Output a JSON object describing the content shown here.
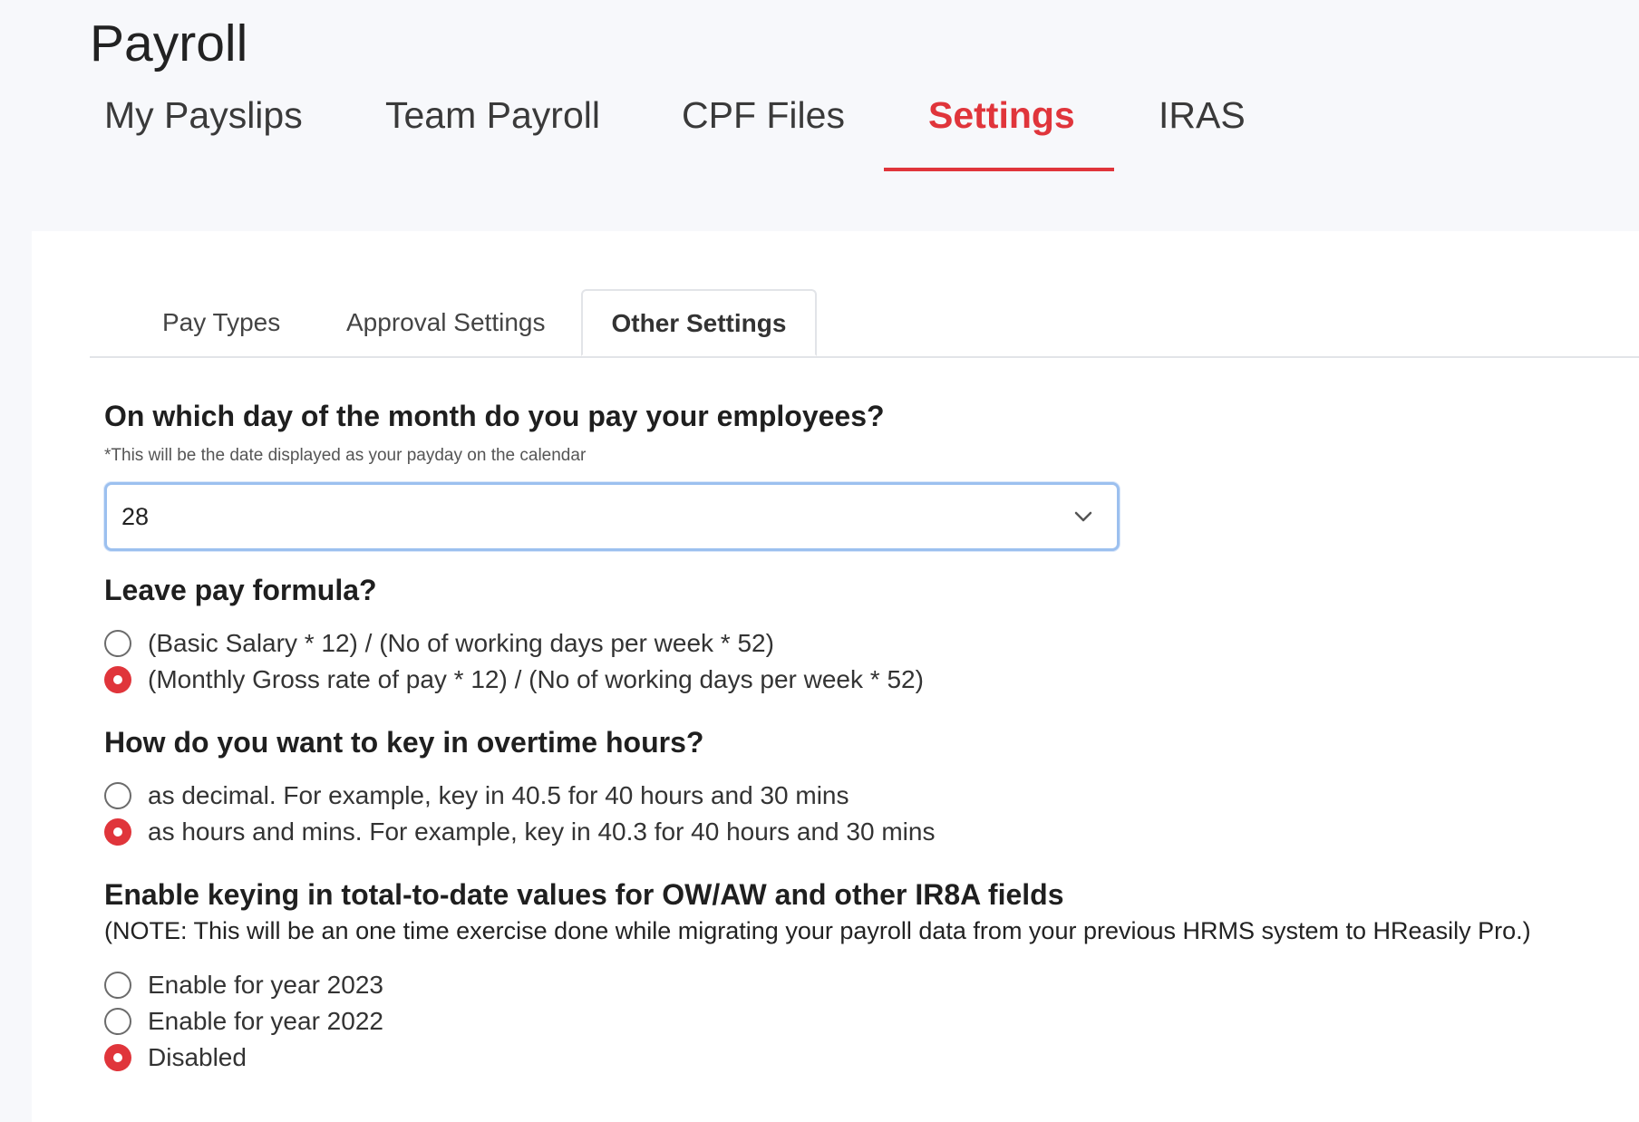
{
  "page": {
    "title": "Payroll"
  },
  "main_tabs": [
    {
      "label": "My Payslips",
      "active": false
    },
    {
      "label": "Team Payroll",
      "active": false
    },
    {
      "label": "CPF Files",
      "active": false
    },
    {
      "label": "Settings",
      "active": true
    },
    {
      "label": "IRAS",
      "active": false
    }
  ],
  "sub_tabs": [
    {
      "label": "Pay Types",
      "active": false
    },
    {
      "label": "Approval Settings",
      "active": false
    },
    {
      "label": "Other Settings",
      "active": true
    }
  ],
  "payday": {
    "question": "On which day of the month do you pay your employees?",
    "hint": "*This will be the date displayed as your payday on the calendar",
    "selected": "28",
    "icon": "chevron-down-icon"
  },
  "leave_formula": {
    "question": "Leave pay formula?",
    "options": [
      {
        "label": "(Basic Salary * 12) / (No of working days per week * 52)",
        "checked": false
      },
      {
        "label": "(Monthly Gross rate of pay * 12) / (No of working days per week * 52)",
        "checked": true
      }
    ]
  },
  "overtime": {
    "question": "How do you want to key in overtime hours?",
    "options": [
      {
        "label": "as decimal. For example, key in 40.5 for 40 hours and 30 mins",
        "checked": false
      },
      {
        "label": "as hours and mins. For example, key in 40.3 for 40 hours and 30 mins",
        "checked": true
      }
    ]
  },
  "ttd": {
    "question": "Enable keying in total-to-date values for OW/AW and other IR8A fields",
    "note": "(NOTE: This will be an one time exercise done while migrating your payroll data from your previous HRMS system to HReasily Pro.)",
    "options": [
      {
        "label": "Enable for year 2023",
        "checked": false
      },
      {
        "label": "Enable for year 2022",
        "checked": false
      },
      {
        "label": "Disabled",
        "checked": true
      }
    ]
  },
  "colors": {
    "accent": "#e0353b",
    "select_border": "#9cc0ef",
    "background": "#f7f8fb"
  }
}
